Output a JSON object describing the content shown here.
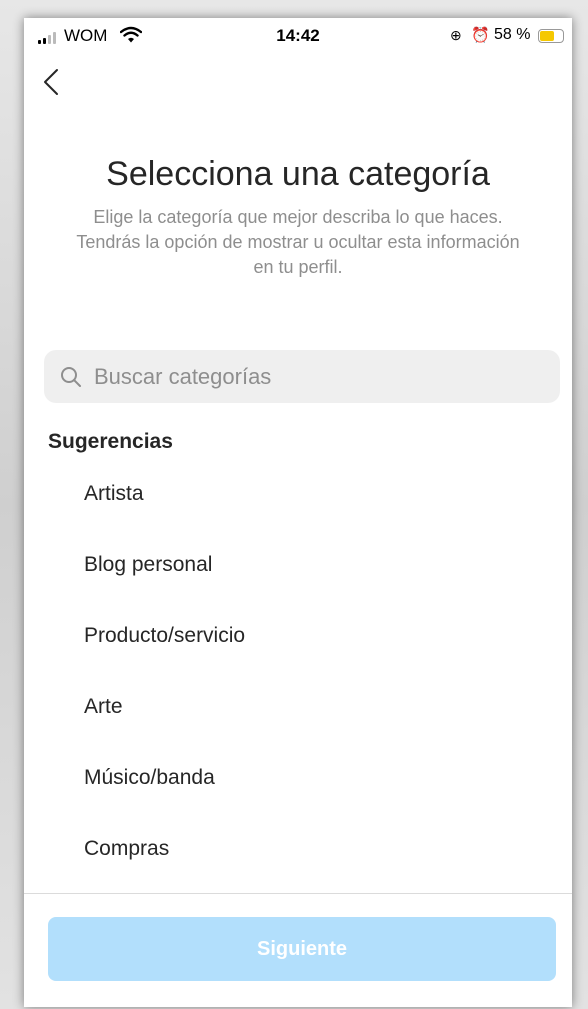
{
  "status_bar": {
    "carrier": "WOM",
    "time": "14:42",
    "battery_percent": "58 %",
    "battery_level": 0.58,
    "battery_color": "#f5c800"
  },
  "nav": {
    "back_icon": "chevron-left-icon"
  },
  "header": {
    "title": "Selecciona una categoría",
    "subtitle": "Elige la categoría que mejor describa lo que haces. Tendrás la opción de mostrar u ocultar esta información en tu perfil."
  },
  "search": {
    "placeholder": "Buscar categorías",
    "value": "",
    "icon": "search-icon"
  },
  "suggestions": {
    "heading": "Sugerencias",
    "items": [
      {
        "label": "Artista"
      },
      {
        "label": "Blog personal"
      },
      {
        "label": "Producto/servicio"
      },
      {
        "label": "Arte"
      },
      {
        "label": "Músico/banda"
      },
      {
        "label": "Compras"
      }
    ]
  },
  "footer": {
    "next_label": "Siguiente",
    "next_enabled": false,
    "next_color": "#b2dffc"
  }
}
